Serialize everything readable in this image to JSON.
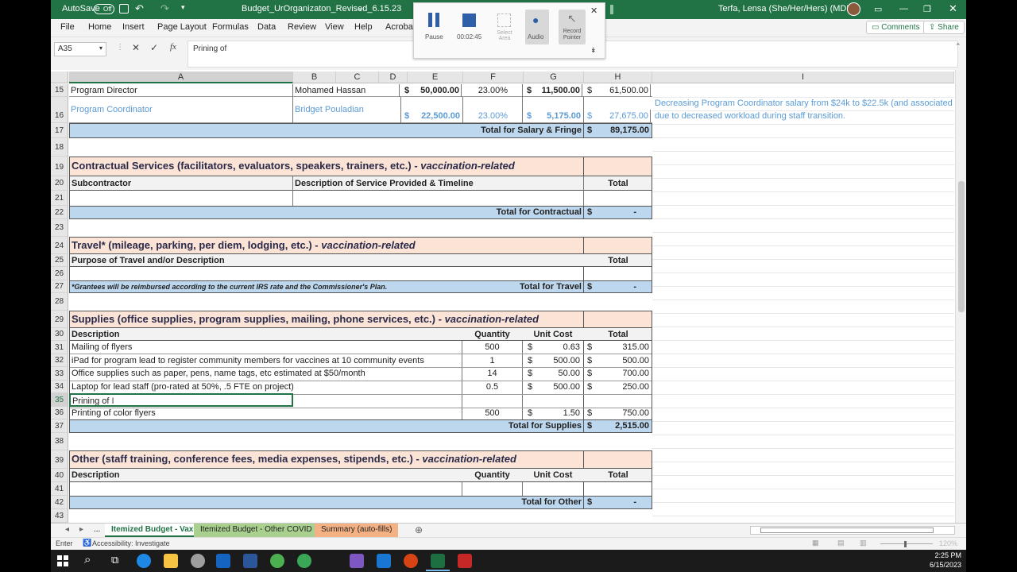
{
  "titlebar": {
    "autosave": "AutoSave",
    "autosave_state": "Off",
    "filename": "Budget_UrOrganizaton_Revised_6.15.23",
    "user": "Terfa, Lensa (She/Her/Hers) (MDH)"
  },
  "recorder": {
    "pause": "Pause",
    "time": "00:02:45",
    "select_area": "Select Area",
    "audio": "Audio",
    "record_pointer": "Record Pointer"
  },
  "ribbon": {
    "menus": [
      "File",
      "Home",
      "Insert",
      "Page Layout",
      "Formulas",
      "Data",
      "Review",
      "View",
      "Help",
      "Acrobat"
    ],
    "comments": "Comments",
    "share": "Share"
  },
  "formula": {
    "namebox": "A35",
    "value": "Prining of"
  },
  "columns": [
    "A",
    "B",
    "C",
    "D",
    "E",
    "F",
    "G",
    "H",
    "I"
  ],
  "rows": {
    "r15": {
      "n": "15",
      "a": "Program Director",
      "b": "Mohamed Hassan",
      "e_sym": "$",
      "e": "50,000.00",
      "f": "23.00%",
      "g_sym": "$",
      "g": "11,500.00",
      "h_sym": "$",
      "h": "61,500.00"
    },
    "r16": {
      "n": "16",
      "a": "Program Coordinator",
      "b": "Bridget Pouladian",
      "e_sym": "$",
      "e": "22,500.00",
      "f": "23.00%",
      "g_sym": "$",
      "g": "5,175.00",
      "h_sym": "$",
      "h": "27,675.00",
      "i1": "Decreasing Program Coordinator salary from $24k to $22.5k (and associated",
      "i2": "due to decreased workload during staff transition."
    },
    "r17": {
      "n": "17",
      "label": "Total for Salary & Fringe",
      "sym": "$",
      "val": "89,175.00"
    },
    "r18": {
      "n": "18"
    },
    "r19": {
      "n": "19",
      "title": "Contractual Services (facilitators, evaluators, speakers, trainers, etc.) - ",
      "tag": "vaccination-related"
    },
    "r20": {
      "n": "20",
      "a": "Subcontractor",
      "b": "Description of Service Provided & Timeline",
      "h": "Total"
    },
    "r21": {
      "n": "21"
    },
    "r22": {
      "n": "22",
      "label": "Total for Contractual",
      "sym": "$",
      "val": "-"
    },
    "r23": {
      "n": "23"
    },
    "r24": {
      "n": "24",
      "title": "Travel* (mileage, parking, per diem, lodging, etc.) - ",
      "tag": "vaccination-related"
    },
    "r25": {
      "n": "25",
      "a": "Purpose of Travel and/or Description",
      "h": "Total"
    },
    "r26": {
      "n": "26"
    },
    "r27": {
      "n": "27",
      "note": "*Grantees will be reimbursed according to the current IRS rate and the Commissioner's Plan.",
      "label": "Total for Travel",
      "sym": "$",
      "val": "-"
    },
    "r28": {
      "n": "28"
    },
    "r29": {
      "n": "29",
      "title": "Supplies (office supplies, program supplies, mailing, phone services, etc.) - ",
      "tag": "vaccination-related"
    },
    "r30": {
      "n": "30",
      "a": "Description",
      "f": "Quantity",
      "g": "Unit Cost",
      "h": "Total"
    },
    "r31": {
      "n": "31",
      "a": "Mailing of flyers",
      "f": "500",
      "g_sym": "$",
      "g": "0.63",
      "h_sym": "$",
      "h": "315.00"
    },
    "r32": {
      "n": "32",
      "a": "iPad for program lead to register community members for vaccines at 10 community events",
      "f": "1",
      "g_sym": "$",
      "g": "500.00",
      "h_sym": "$",
      "h": "500.00"
    },
    "r33": {
      "n": "33",
      "a": "Office supplies such as paper, pens, name tags, etc estimated at $50/month",
      "f": "14",
      "g_sym": "$",
      "g": "50.00",
      "h_sym": "$",
      "h": "700.00"
    },
    "r34": {
      "n": "34",
      "a": "Laptop for lead staff (pro-rated at 50%, .5 FTE on project)",
      "f": "0.5",
      "g_sym": "$",
      "g": "500.00",
      "h_sym": "$",
      "h": "250.00"
    },
    "r35": {
      "n": "35",
      "a": "Prining of"
    },
    "r36": {
      "n": "36",
      "a": "Printing of color flyers",
      "f": "500",
      "g_sym": "$",
      "g": "1.50",
      "h_sym": "$",
      "h": "750.00"
    },
    "r37": {
      "n": "37",
      "label": "Total for Supplies",
      "sym": "$",
      "val": "2,515.00"
    },
    "r38": {
      "n": "38"
    },
    "r39": {
      "n": "39",
      "title": "Other (staff training, conference fees, media expenses, stipends, etc.) - ",
      "tag": "vaccination-related"
    },
    "r40": {
      "n": "40",
      "a": "Description",
      "f": "Quantity",
      "g": "Unit Cost",
      "h": "Total"
    },
    "r41": {
      "n": "41"
    },
    "r42": {
      "n": "42",
      "label": "Total for Other",
      "sym": "$",
      "val": "-"
    },
    "r43": {
      "n": "43"
    }
  },
  "tabs": {
    "ellipsis": "...",
    "t1": "Itemized Budget - Vax",
    "t2": "Itemized Budget - Other COVID",
    "t3": "Summary (auto-fills)"
  },
  "status": {
    "mode": "Enter",
    "accessibility": "Accessibility: Investigate",
    "zoom": "120%"
  },
  "clock": {
    "time": "2:25 PM",
    "date": "6/15/2023"
  },
  "colors": {
    "excel_green": "#217346",
    "section_peach": "#fbe3d6",
    "total_blue": "#bdd7ee",
    "note_blue": "#5b9bd5"
  }
}
